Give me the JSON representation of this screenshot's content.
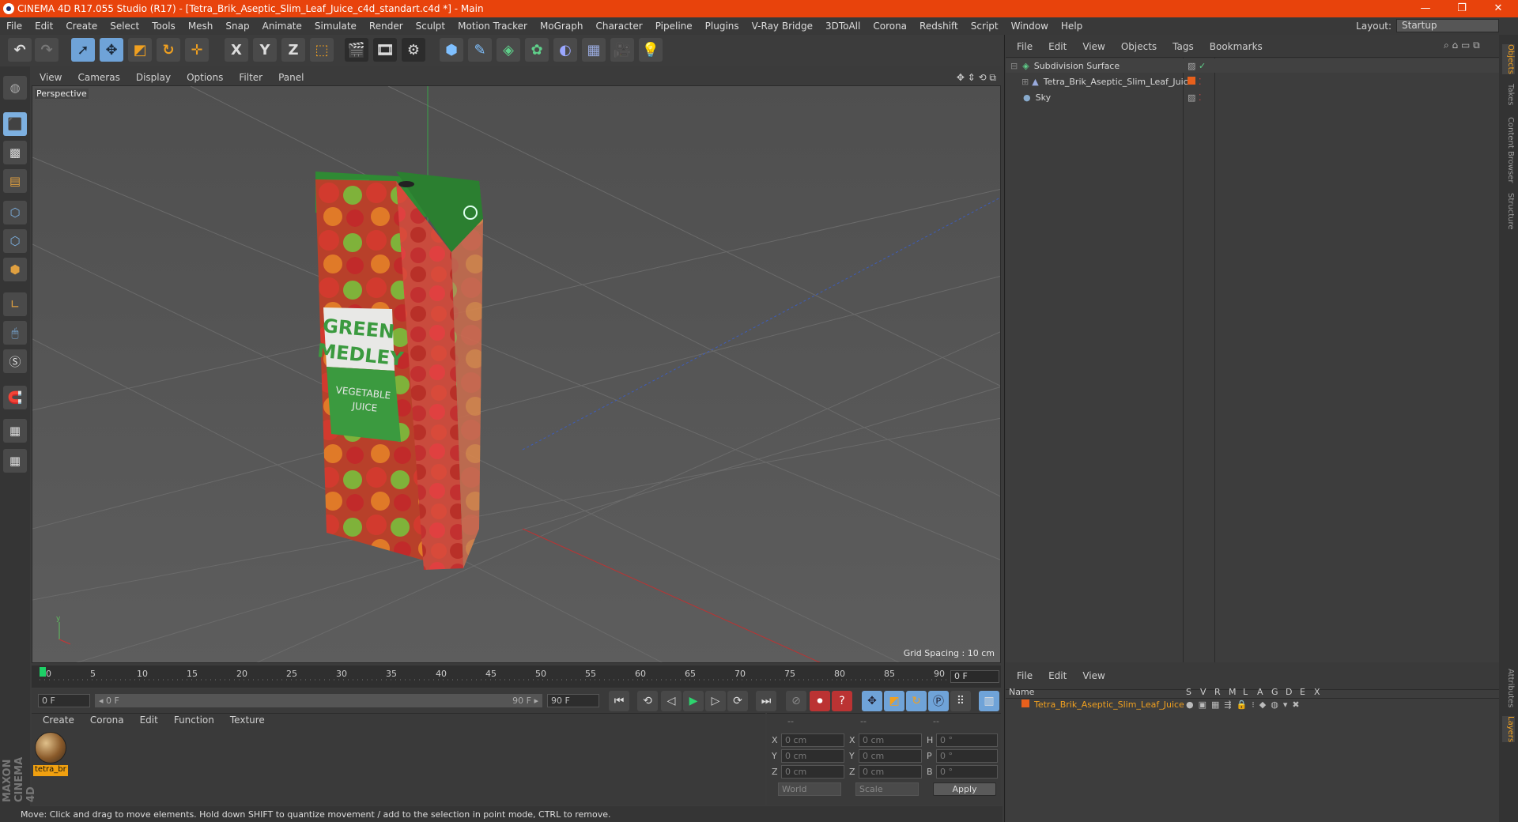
{
  "window": {
    "title": "CINEMA 4D R17.055 Studio (R17) - [Tetra_Brik_Aseptic_Slim_Leaf_Juice_c4d_standart.c4d *] - Main",
    "minimize": "—",
    "restore": "❐",
    "close": "✕"
  },
  "menu": [
    "File",
    "Edit",
    "Create",
    "Select",
    "Tools",
    "Mesh",
    "Snap",
    "Animate",
    "Simulate",
    "Render",
    "Sculpt",
    "Motion Tracker",
    "MoGraph",
    "Character",
    "Pipeline",
    "Plugins",
    "V-Ray Bridge",
    "3DToAll",
    "Corona",
    "Redshift",
    "Script",
    "Window",
    "Help"
  ],
  "layout": {
    "label": "Layout:",
    "value": "Startup"
  },
  "toolbar": {
    "x": "X",
    "y": "Y",
    "z": "Z"
  },
  "viewport": {
    "menu": [
      "View",
      "Cameras",
      "Display",
      "Options",
      "Filter",
      "Panel"
    ],
    "label": "Perspective",
    "grid_spacing": "Grid Spacing : 10 cm"
  },
  "product": {
    "line1": "GREEN",
    "line2": "MEDLEY",
    "sub1": "VEGETABLE",
    "sub2": "JUICE"
  },
  "timeline": {
    "ticks": [
      "0",
      "5",
      "10",
      "15",
      "20",
      "25",
      "30",
      "35",
      "40",
      "45",
      "50",
      "55",
      "60",
      "65",
      "70",
      "75",
      "80",
      "85",
      "90"
    ],
    "frame": "0 F",
    "start": "0 F",
    "range_start": "◂ 0 F",
    "range_end": "90 F ▸",
    "end": "90 F"
  },
  "material": {
    "menu": [
      "Create",
      "Corona",
      "Edit",
      "Function",
      "Texture"
    ],
    "name": "tetra_br"
  },
  "coords": {
    "head": [
      "--",
      "--",
      "--"
    ],
    "rows": [
      {
        "a": "X",
        "av": "0 cm",
        "b": "X",
        "bv": "0 cm",
        "c": "H",
        "cv": "0 °"
      },
      {
        "a": "Y",
        "av": "0 cm",
        "b": "Y",
        "bv": "0 cm",
        "c": "P",
        "cv": "0 °"
      },
      {
        "a": "Z",
        "av": "0 cm",
        "b": "Z",
        "bv": "0 cm",
        "c": "B",
        "cv": "0 °"
      }
    ],
    "mode1": "World",
    "mode2": "Scale",
    "apply": "Apply"
  },
  "objects": {
    "menu": [
      "File",
      "Edit",
      "View",
      "Objects",
      "Tags",
      "Bookmarks"
    ],
    "items": [
      {
        "name": "Subdivision Surface",
        "color": "#d6d6d6"
      },
      {
        "name": "Tetra_Brik_Aseptic_Slim_Leaf_Juice",
        "color": "#d6d6d6"
      },
      {
        "name": "Sky",
        "color": "#d6d6d6"
      }
    ]
  },
  "layers": {
    "menu": [
      "File",
      "Edit",
      "View"
    ],
    "header": "Name",
    "cols": [
      "S",
      "V",
      "R",
      "M",
      "L",
      "A",
      "G",
      "D",
      "E",
      "X"
    ],
    "row": "Tetra_Brik_Aseptic_Slim_Leaf_Juice"
  },
  "sidetabs": [
    "Objects",
    "Takes",
    "Content Browser",
    "Structure",
    "Attributes",
    "Layers"
  ],
  "maxon": "MAXON CINEMA 4D",
  "status": "Move: Click and drag to move elements. Hold down SHIFT to quantize movement / add to the selection in point mode, CTRL to remove."
}
